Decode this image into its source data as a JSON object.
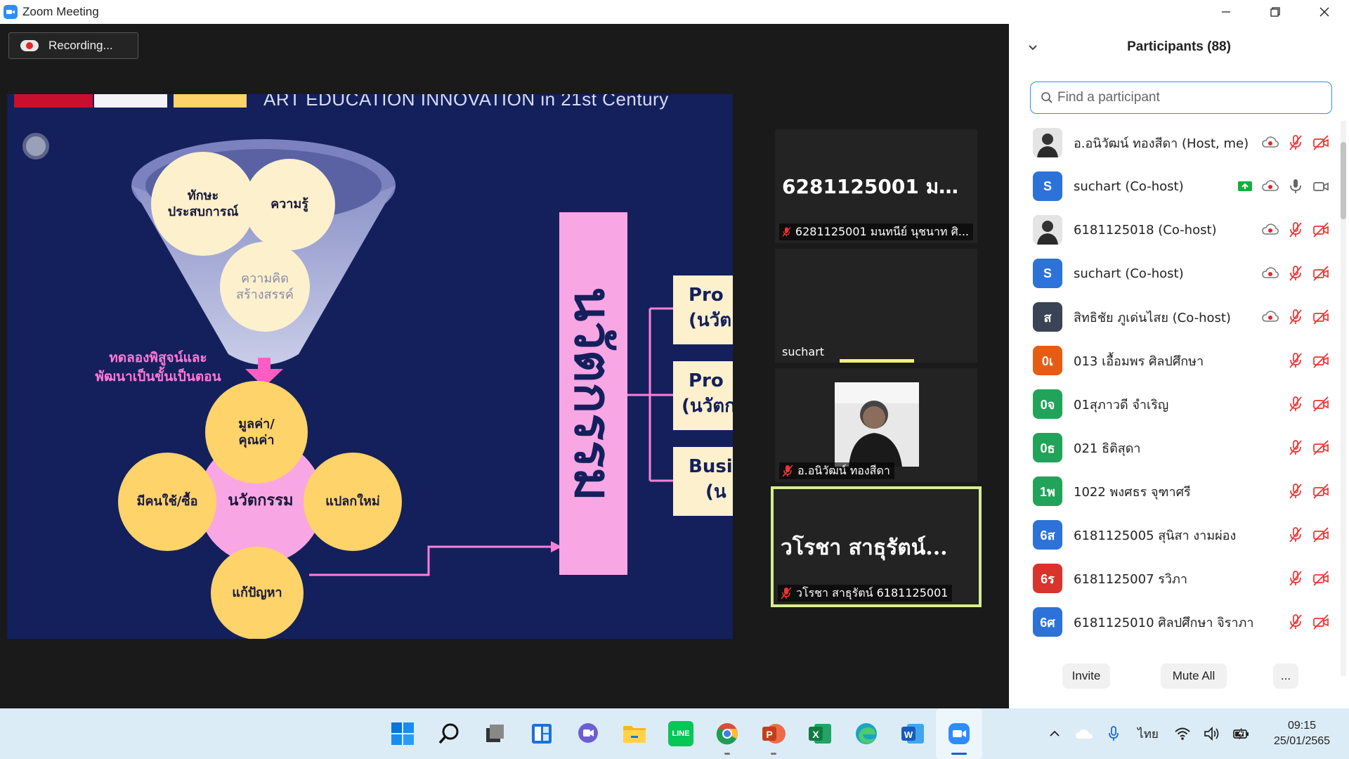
{
  "window": {
    "title": "Zoom Meeting"
  },
  "recording": {
    "label": "Recording..."
  },
  "slide": {
    "header": "ART EDUCATION INNOVATION in 21st Century",
    "funnel_top_left": "ทักษะ ประสบการณ์",
    "funnel_top_right": "ความรู้",
    "funnel_bottom": "ความคิด สร้างสรรค์",
    "side_text_1": "ทดลองพิสูจน์และ",
    "side_text_2": "พัฒนาเป็นขั้นเป็นตอน",
    "center": "นวัตกรรม",
    "top": "มูลค่า/ คุณค่า",
    "left": "มีคนใช้/ซื้อ",
    "right": "แปลกใหม่",
    "bottom": "แก้ปัญหา",
    "bar": "นวัตกรรม",
    "box1_l1": "Pro",
    "box1_l2": "(นวัต",
    "box2_l1": "Pro",
    "box2_l2": "(นวัตก",
    "box3_l1": "Busi",
    "box3_l2": "(น"
  },
  "videos": [
    {
      "big": "6281125001 มน...",
      "label": "6281125001 มนทนีย์ นุชนาท ศิ..."
    },
    {
      "label": "suchart"
    },
    {
      "label": "อ.อนิวัฒน์ ทองสีดา"
    },
    {
      "big": "วโรชา สาธุรัตน์...",
      "label": "วโรชา สาธุรัตน์ 6181125001"
    }
  ],
  "panel": {
    "title": "Participants (88)",
    "search_placeholder": "Find a participant",
    "invite": "Invite",
    "mute_all": "Mute All",
    "more": "...",
    "participants": [
      {
        "initials": "",
        "name": "อ.อนิวัฒน์ ทองสีดา (Host, me)",
        "color": "#cccccc"
      },
      {
        "initials": "S",
        "name": "suchart (Co-host)",
        "color": "#2d72d8"
      },
      {
        "initials": "",
        "name": "6181125018 (Co-host)",
        "color": "#cccccc"
      },
      {
        "initials": "S",
        "name": "suchart (Co-host)",
        "color": "#2d72d8"
      },
      {
        "initials": "ส",
        "name": "สิทธิชัย ภูเด่นไสย (Co-host)",
        "color": "#3a4456"
      },
      {
        "initials": "0เ",
        "name": "013 เอื้อมพร ศิลปศึกษา",
        "color": "#e65c14"
      },
      {
        "initials": "0จ",
        "name": "01สุภาวดี จำเริญ",
        "color": "#22a35a"
      },
      {
        "initials": "0ธ",
        "name": "021 ธิติสุดา",
        "color": "#22a35a"
      },
      {
        "initials": "1พ",
        "name": "1022 พงศธร จุฑาศรี",
        "color": "#22a35a"
      },
      {
        "initials": "6ส",
        "name": "6181125005 สุนิสา งามผ่อง",
        "color": "#2d72d8"
      },
      {
        "initials": "6ร",
        "name": "6181125007 รวิภา",
        "color": "#d8342c"
      },
      {
        "initials": "6ศ",
        "name": "6181125010 ศิลปศึกษา จิราภา",
        "color": "#2d72d8"
      }
    ]
  },
  "taskbar": {
    "lang": "ไทย",
    "time": "09:15",
    "date": "25/01/2565"
  },
  "colors": {
    "slide_bg": "#13205c",
    "pink": "#f9a6e4",
    "yellow": "#fdd36a",
    "accent": "#2d8cff"
  }
}
